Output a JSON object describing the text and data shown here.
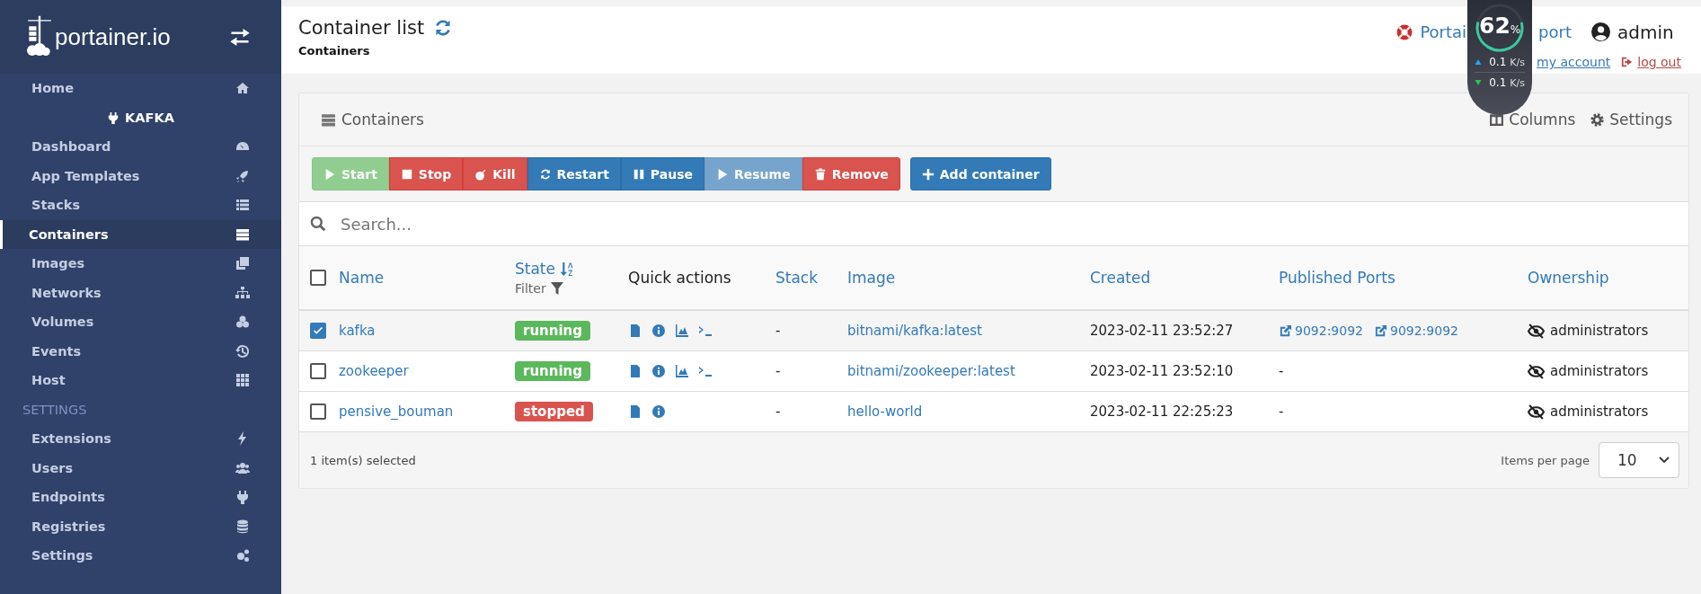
{
  "sidebar": {
    "logo": "portainer.io",
    "items": [
      {
        "label": "Home",
        "selected": false
      }
    ],
    "endpoint": "KAFKA",
    "endpoint_items": [
      {
        "label": "Dashboard",
        "selected": false
      },
      {
        "label": "App Templates",
        "selected": false
      },
      {
        "label": "Stacks",
        "selected": false
      },
      {
        "label": "Containers",
        "selected": true
      },
      {
        "label": "Images",
        "selected": false
      },
      {
        "label": "Networks",
        "selected": false
      },
      {
        "label": "Volumes",
        "selected": false
      },
      {
        "label": "Events",
        "selected": false
      },
      {
        "label": "Host",
        "selected": false
      }
    ],
    "settings_heading": "SETTINGS",
    "settings_items": [
      {
        "label": "Extensions",
        "selected": false
      },
      {
        "label": "Users",
        "selected": false
      },
      {
        "label": "Endpoints",
        "selected": false
      },
      {
        "label": "Registries",
        "selected": false
      },
      {
        "label": "Settings",
        "selected": false
      }
    ]
  },
  "header": {
    "title": "Container list",
    "breadcrumb": "Containers",
    "support_link_start": "Portai",
    "support_link_end": "port",
    "user": "admin",
    "account_link": "my account",
    "logout_link": "log out"
  },
  "speed_widget": {
    "level": 0.62,
    "percent": "62",
    "percent_unit": "%",
    "upload": "0.1",
    "upload_unit": "K/s",
    "download": "0.1",
    "download_unit": "K/s"
  },
  "panel": {
    "title": "Containers",
    "columns_button": "Columns",
    "settings_button": "Settings",
    "actions": [
      {
        "label": "Start",
        "kind": "success",
        "disabled": true
      },
      {
        "label": "Stop",
        "kind": "danger",
        "disabled": false
      },
      {
        "label": "Kill",
        "kind": "danger",
        "disabled": false
      },
      {
        "label": "Restart",
        "kind": "primary",
        "disabled": false
      },
      {
        "label": "Pause",
        "kind": "primary",
        "disabled": false
      },
      {
        "label": "Resume",
        "kind": "primary",
        "disabled": true
      },
      {
        "label": "Remove",
        "kind": "danger",
        "disabled": false
      }
    ],
    "add_button": "Add container",
    "search": {
      "placeholder": "Search..."
    },
    "table": {
      "select_all": {
        "checked": false
      },
      "columns": [
        {
          "label": "Name",
          "kind": "link"
        },
        {
          "label": "State",
          "kind": "sort",
          "filter": "Filter"
        },
        {
          "label": "Quick actions",
          "kind": "plain"
        },
        {
          "label": "Stack",
          "kind": "link"
        },
        {
          "label": "Image",
          "kind": "link"
        },
        {
          "label": "Created",
          "kind": "link"
        },
        {
          "label": "Published Ports",
          "kind": "link"
        },
        {
          "label": "Ownership",
          "kind": "link"
        }
      ],
      "rows": [
        {
          "checked": true,
          "name": "kafka",
          "state": {
            "label": "running",
            "color": "#5cb85c"
          },
          "actions": [
            {
              "kind": "logs"
            },
            {
              "kind": "inspect"
            },
            {
              "kind": "stats"
            },
            {
              "kind": "console"
            }
          ],
          "stack": "-",
          "image": "bitnami/kafka:latest",
          "created": "2023-02-11 23:52:27",
          "ports": [
            "9092:9092",
            "9092:9092"
          ],
          "ownership": "administrators"
        },
        {
          "checked": false,
          "name": "zookeeper",
          "state": {
            "label": "running",
            "color": "#5cb85c"
          },
          "actions": [
            {
              "kind": "logs"
            },
            {
              "kind": "inspect"
            },
            {
              "kind": "stats"
            },
            {
              "kind": "console"
            }
          ],
          "stack": "-",
          "image": "bitnami/zookeeper:latest",
          "created": "2023-02-11 23:52:10",
          "ports_empty": "-",
          "ownership": "administrators"
        },
        {
          "checked": false,
          "name": "pensive_bouman",
          "state": {
            "label": "stopped",
            "color": "#d9534f"
          },
          "actions": [
            {
              "kind": "logs"
            },
            {
              "kind": "inspect"
            }
          ],
          "stack": "-",
          "image": "hello-world",
          "created": "2023-02-11 22:25:23",
          "ports_empty": "-",
          "ownership": "administrators"
        }
      ]
    },
    "selected_count": "1 item(s) selected",
    "items_per_page_label": "Items per page",
    "items_per_page": "10"
  }
}
